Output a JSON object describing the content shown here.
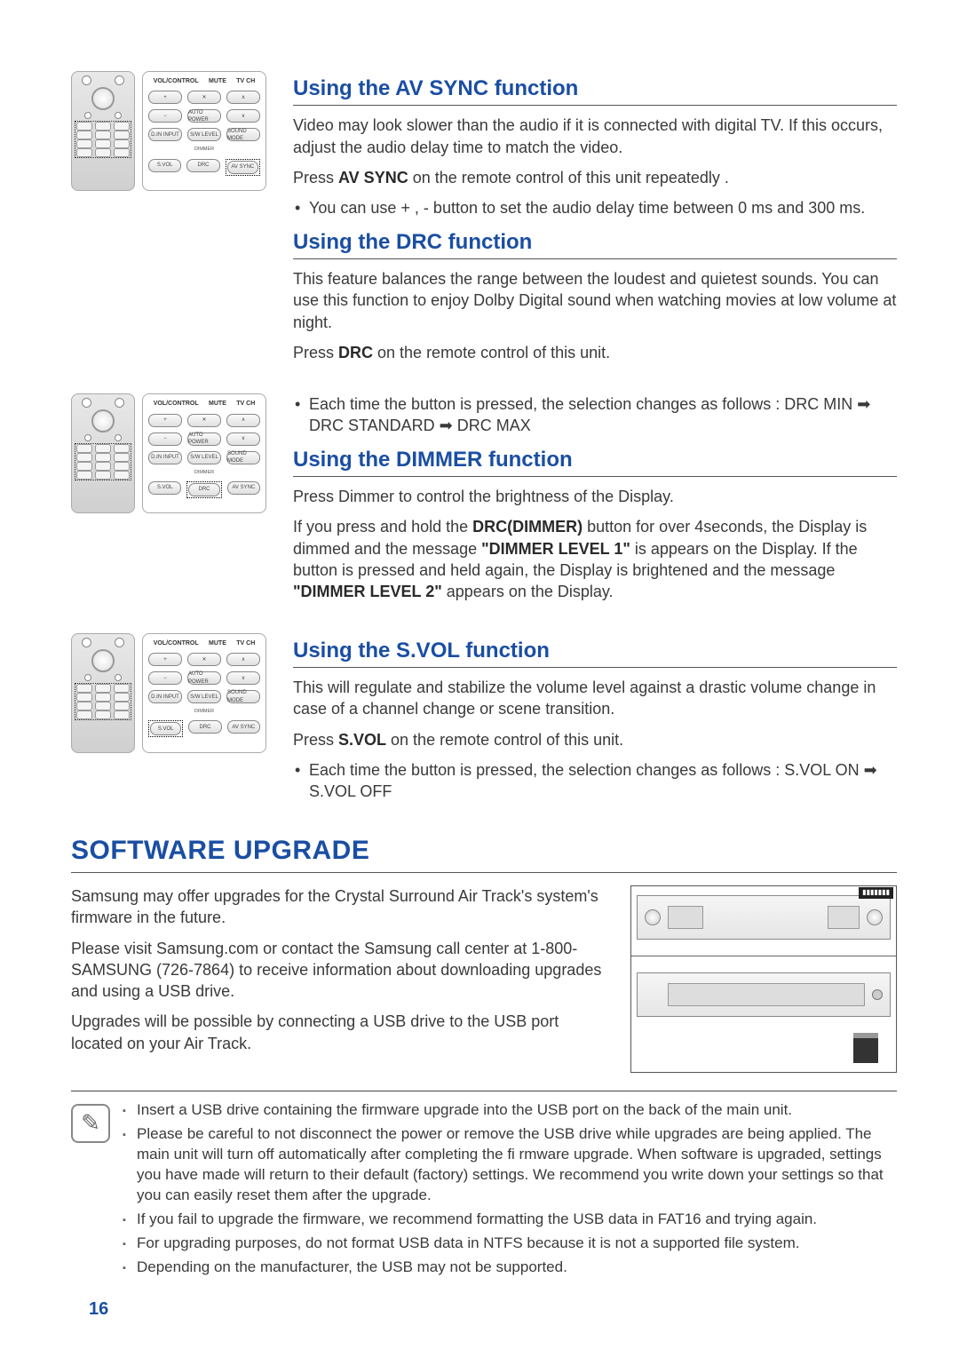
{
  "remote": {
    "hdr_vol": "VOL/CONTROL",
    "hdr_mute": "MUTE",
    "hdr_tvch": "TV CH",
    "row2_label": "AUTO POWER",
    "row3_a": "D.IN INPUT",
    "row3_b": "S/W LEVEL",
    "row3_c": "SOUND MODE",
    "row4_dimmer": "DIMMER",
    "row4_a": "S.VOL",
    "row4_b": "DRC",
    "row4_c": "AV SYNC"
  },
  "sec1": {
    "title": "Using the AV SYNC function",
    "p1": "Video may look slower than the audio if it is connected with digital TV. If this occurs, adjust the audio delay time to match the video.",
    "p2a": "Press ",
    "p2b": "AV SYNC",
    "p2c": " on the remote control of this unit repeatedly .",
    "b1": "You can use + , - button to set the audio delay time between 0 ms and 300 ms."
  },
  "sec2": {
    "title": "Using the DRC function",
    "p1": "This feature balances the range between the loudest and quietest sounds. You can use this function to enjoy Dolby Digital sound when watching movies at low volume at night.",
    "p2a": "Press ",
    "p2b": "DRC",
    "p2c": " on the remote control of this unit.",
    "b1": "Each time the button is pressed, the selection changes as follows : DRC MIN ➡ DRC STANDARD ➡ DRC MAX"
  },
  "sec3": {
    "title": "Using the DIMMER function",
    "p1": "Press Dimmer to control the brightness of the Display.",
    "p2a": "If you press and hold the ",
    "p2b": "DRC(DIMMER)",
    "p2c": " button for over 4seconds, the Display is dimmed and the message  ",
    "p2d": "\"DIMMER LEVEL 1\"",
    "p2e": " is appears on the Display. If the button is pressed and held again, the Display is brightened and the message ",
    "p2f": "\"DIMMER LEVEL 2\"",
    "p2g": " appears on the Display."
  },
  "sec4": {
    "title": "Using the S.VOL function",
    "p1": "This will regulate and stabilize the volume level against a drastic volume change in case of a channel change or scene transition.",
    "p2a": "Press ",
    "p2b": "S.VOL",
    "p2c": " on the remote control of this unit.",
    "b1": "Each time the button is pressed, the selection changes as follows : S.VOL ON ➡ S.VOL OFF"
  },
  "sw": {
    "title": "SOFTWARE UPGRADE",
    "p1": "Samsung may offer upgrades for the Crystal Surround Air Track's system's firmware in the future.",
    "p2": "Please visit Samsung.com or contact the Samsung call center at 1-800-SAMSUNG (726-7864) to receive information about downloading upgrades and using a USB drive.",
    "p3": "Upgrades will be possible by connecting a USB drive to the USB port located on your Air Track."
  },
  "notes": {
    "n1": "Insert a USB drive containing the firmware upgrade into the USB port on the back of the main unit.",
    "n2": "Please be careful to not disconnect the power or remove the USB drive while upgrades are being applied. The main unit will turn off automatically after completing the fi rmware upgrade. When software is upgraded, settings you have made will return to their default (factory) settings. We recommend you write down your settings so that you can easily reset them after the upgrade.",
    "n3": "If you fail to upgrade the firmware, we recommend formatting the USB data in FAT16 and trying again.",
    "n4": "For upgrading purposes, do not format USB data in NTFS because it is not a supported file system.",
    "n5": "Depending on the manufacturer, the USB may not be supported."
  },
  "page": "16"
}
